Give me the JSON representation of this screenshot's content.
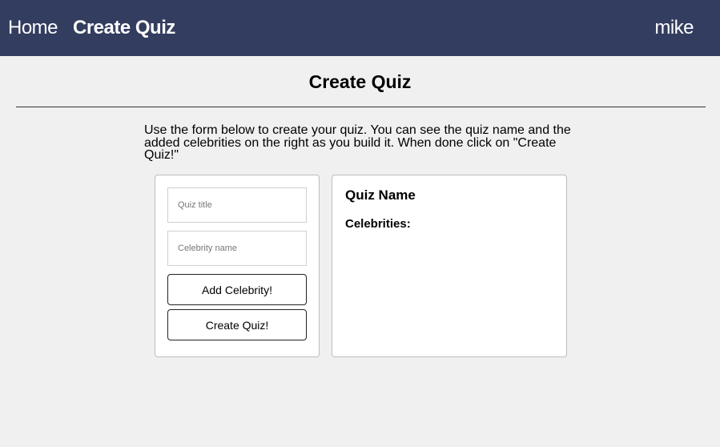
{
  "nav": {
    "home_label": "Home",
    "create_quiz_label": "Create Quiz",
    "username": "mike"
  },
  "page": {
    "title": "Create Quiz",
    "instructions": "Use the form below to create your quiz. You can see the quiz name and the added celebrities on the right as you build it. When done click on \"Create Quiz!\""
  },
  "form": {
    "quiz_title": {
      "value": "",
      "placeholder": "Quiz title"
    },
    "celebrity_name": {
      "value": "",
      "placeholder": "Celebrity name"
    },
    "add_celebrity_label": "Add Celebrity!",
    "create_quiz_button_label": "Create Quiz!"
  },
  "preview": {
    "quiz_name": "Quiz Name",
    "celebrities_label": "Celebrities:",
    "celebrities": []
  },
  "colors": {
    "navbar_bg": "#333d5f",
    "page_bg": "#f0f0f0"
  }
}
